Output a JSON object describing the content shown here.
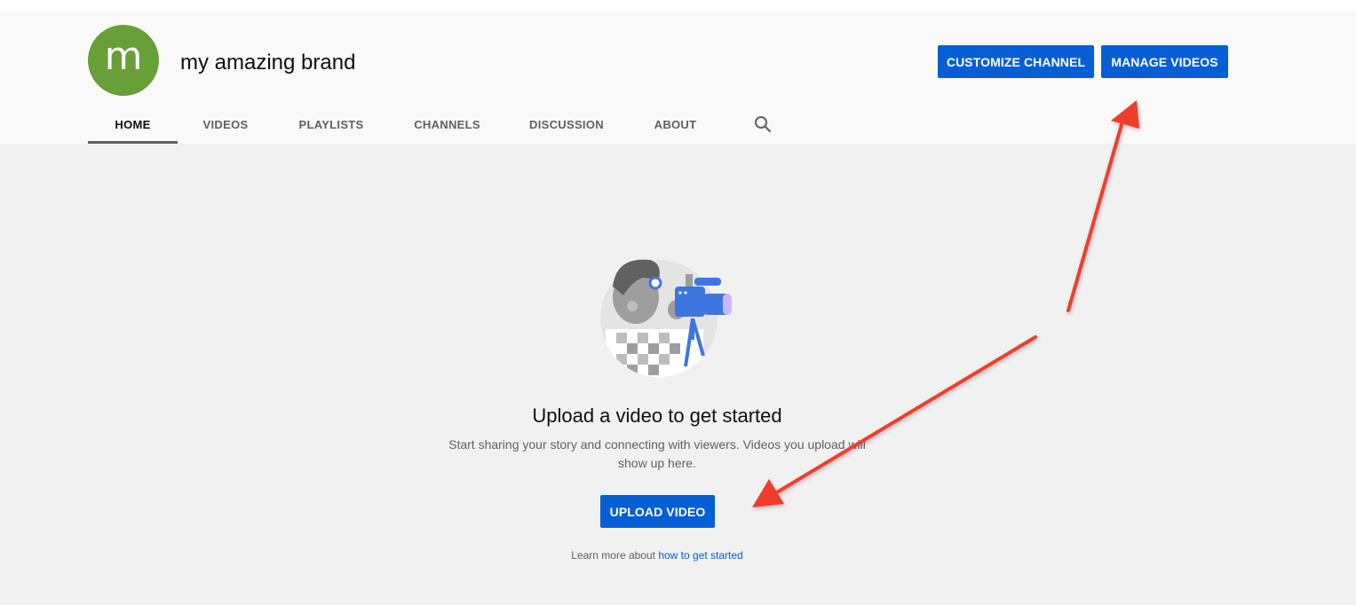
{
  "channel": {
    "avatar_letter": "m",
    "name": "my amazing brand"
  },
  "header_buttons": {
    "customize": "CUSTOMIZE CHANNEL",
    "manage": "MANAGE VIDEOS"
  },
  "tabs": [
    {
      "label": "HOME",
      "active": true
    },
    {
      "label": "VIDEOS",
      "active": false
    },
    {
      "label": "PLAYLISTS",
      "active": false
    },
    {
      "label": "CHANNELS",
      "active": false
    },
    {
      "label": "DISCUSSION",
      "active": false
    },
    {
      "label": "ABOUT",
      "active": false
    }
  ],
  "tab_search_icon": "search-icon",
  "empty_state": {
    "illustration": "camera-operator-illustration",
    "title": "Upload a video to get started",
    "description": "Start sharing your story and connecting with viewers. Videos you upload will show up here.",
    "upload_button": "UPLOAD VIDEO",
    "learn_more_prefix": "Learn more about ",
    "learn_more_link": "how to get started"
  },
  "colors": {
    "primary_blue": "#065fd4",
    "avatar_green": "#689f38",
    "annotation_red": "#f03c2e"
  }
}
